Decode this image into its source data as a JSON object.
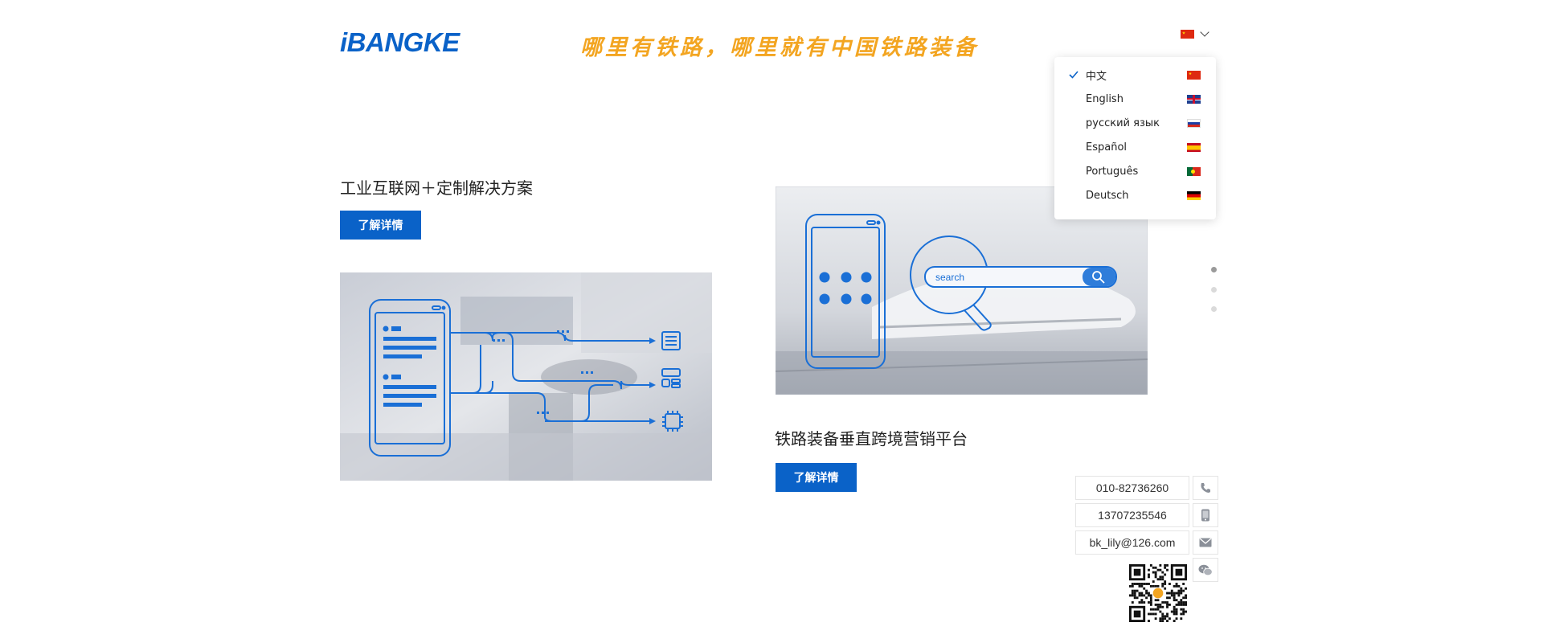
{
  "header": {
    "logo_text": "iBANGKE",
    "slogan": "哪里有铁路，哪里就有中国铁路装备",
    "current_language_flag": "flag-cn"
  },
  "language_menu": {
    "items": [
      {
        "label": "中文",
        "selected": true,
        "flag": "flag-cn"
      },
      {
        "label": "English",
        "selected": false,
        "flag": "flag-gb"
      },
      {
        "label": "русский язык",
        "selected": false,
        "flag": "flag-ru"
      },
      {
        "label": "Español",
        "selected": false,
        "flag": "flag-es"
      },
      {
        "label": "Português",
        "selected": false,
        "flag": "flag-pt"
      },
      {
        "label": "Deutsch",
        "selected": false,
        "flag": "flag-de"
      }
    ]
  },
  "cards": [
    {
      "title": "工业互联网＋定制解决方案",
      "button": "了解详情"
    },
    {
      "title": "铁路装备垂直跨境营销平台",
      "button": "了解详情",
      "search_placeholder": "search"
    }
  ],
  "pagination": {
    "count": 3,
    "active_index": 0
  },
  "contact": {
    "phone": "010-82736260",
    "mobile": "13707235546",
    "email": "bk_lily@126.com",
    "icons": [
      "phone-icon",
      "mobile-icon",
      "mail-icon",
      "wechat-icon"
    ]
  },
  "colors": {
    "brand_blue": "#0a62c8",
    "slogan_orange": "#f3a521",
    "illustration_blue": "#1a6fd6"
  }
}
